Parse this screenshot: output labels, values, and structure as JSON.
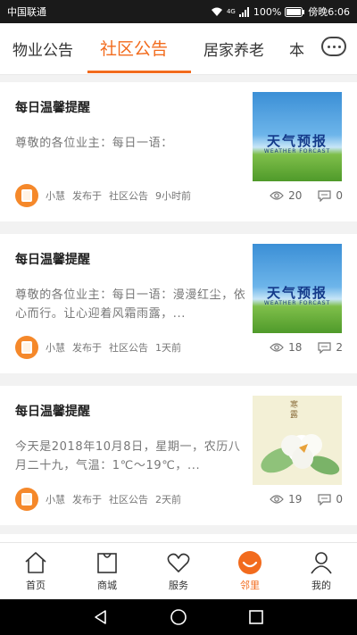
{
  "status_bar": {
    "carrier": "中国联通",
    "network": "4G",
    "battery": "100%",
    "time": "傍晚6:06"
  },
  "tabs": [
    {
      "label": "物业公告",
      "active": false
    },
    {
      "label": "社区公告",
      "active": true
    },
    {
      "label": "居家养老",
      "active": false
    },
    {
      "label": "本",
      "active": false
    }
  ],
  "accent_color": "#f26b1d",
  "cards": [
    {
      "title": "每日温馨提醒",
      "excerpt": "尊敬的各位业主：每日一语：",
      "author": "小慧",
      "published": "发布于",
      "category": "社区公告",
      "time": "9小时前",
      "views": "20",
      "comments": "0",
      "thumb": {
        "type": "weather",
        "title": "天气预报",
        "subtitle": "WEATHER FORCAST"
      }
    },
    {
      "title": "每日温馨提醒",
      "excerpt": "尊敬的各位业主：每日一语：漫漫红尘，依心而行。让心迎着风霜雨露，...",
      "author": "小慧",
      "published": "发布于",
      "category": "社区公告",
      "time": "1天前",
      "views": "18",
      "comments": "2",
      "thumb": {
        "type": "weather",
        "title": "天气预报",
        "subtitle": "WEATHER FORCAST"
      }
    },
    {
      "title": "每日温馨提醒",
      "excerpt": "今天是2018年10月8日，星期一，农历八月二十九，气温：1℃～19℃，...",
      "author": "小慧",
      "published": "发布于",
      "category": "社区公告",
      "time": "2天前",
      "views": "19",
      "comments": "0",
      "thumb": {
        "type": "flower",
        "title": "寒露"
      }
    }
  ],
  "bottom_nav": [
    {
      "label": "首页",
      "icon": "home-icon",
      "active": false
    },
    {
      "label": "商城",
      "icon": "shopping-bag-icon",
      "active": false
    },
    {
      "label": "服务",
      "icon": "heart-icon",
      "active": false
    },
    {
      "label": "邻里",
      "icon": "smile-icon",
      "active": true
    },
    {
      "label": "我的",
      "icon": "user-icon",
      "active": false
    }
  ]
}
